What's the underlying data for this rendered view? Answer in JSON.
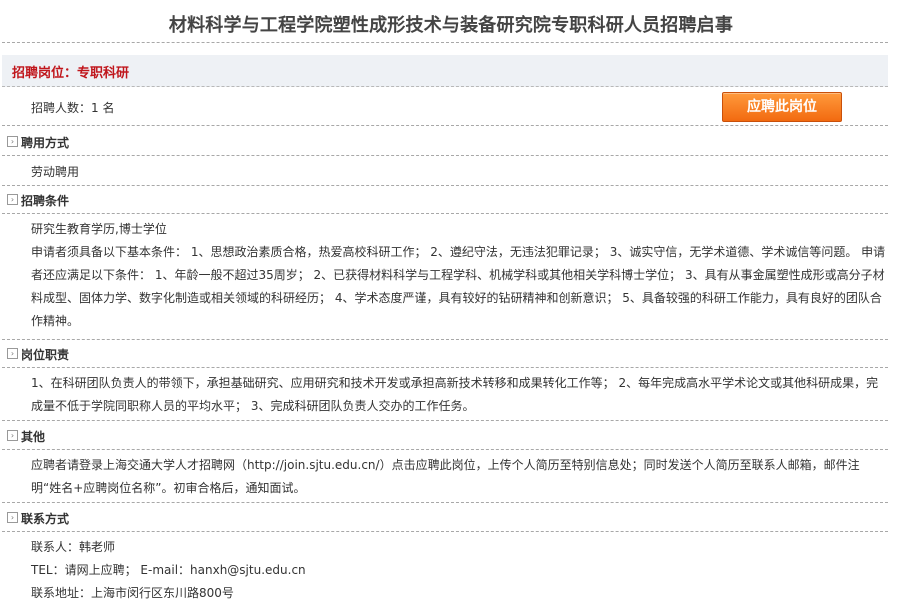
{
  "page": {
    "title": "材料科学与工程学院塑性成形技术与装备研究院专职科研人员招聘启事"
  },
  "position": {
    "label": "招聘岗位：专职科研",
    "count_text": "招聘人数：1 名",
    "apply_button": "应聘此岗位"
  },
  "sections": {
    "employment": {
      "title": "聘用方式",
      "lines": [
        "劳动聘用"
      ]
    },
    "conditions": {
      "title": "招聘条件",
      "lines": [
        "研究生教育学历,博士学位",
        "申请者须具备以下基本条件： 1、思想政治素质合格，热爱高校科研工作； 2、遵纪守法，无违法犯罪记录； 3、诚实守信，无学术道德、学术诚信等问题。 申请者还应满足以下条件： 1、年龄一般不超过35周岁； 2、已获得材料科学与工程学科、机械学科或其他相关学科博士学位； 3、具有从事金属塑性成形或高分子材料成型、固体力学、数字化制造或相关领域的科研经历； 4、学术态度严谨，具有较好的钻研精神和创新意识； 5、具备较强的科研工作能力，具有良好的团队合作精神。"
      ]
    },
    "duties": {
      "title": "岗位职责",
      "lines": [
        "1、在科研团队负责人的带领下，承担基础研究、应用研究和技术开发或承担高新技术转移和成果转化工作等； 2、每年完成高水平学术论文或其他科研成果，完成量不低于学院同职称人员的平均水平； 3、完成科研团队负责人交办的工作任务。"
      ]
    },
    "other": {
      "title": "其他",
      "lines": [
        "应聘者请登录上海交通大学人才招聘网（http://join.sjtu.edu.cn/）点击应聘此岗位，上传个人简历至特别信息处；同时发送个人简历至联系人邮箱，邮件注明“姓名+应聘岗位名称”。初审合格后，通知面试。"
      ]
    },
    "contact": {
      "title": "联系方式",
      "lines": [
        "联系人：韩老师",
        "TEL：请网上应聘； E-mail：hanxh@sjtu.edu.cn",
        "联系地址：上海市闵行区东川路800号"
      ]
    }
  }
}
